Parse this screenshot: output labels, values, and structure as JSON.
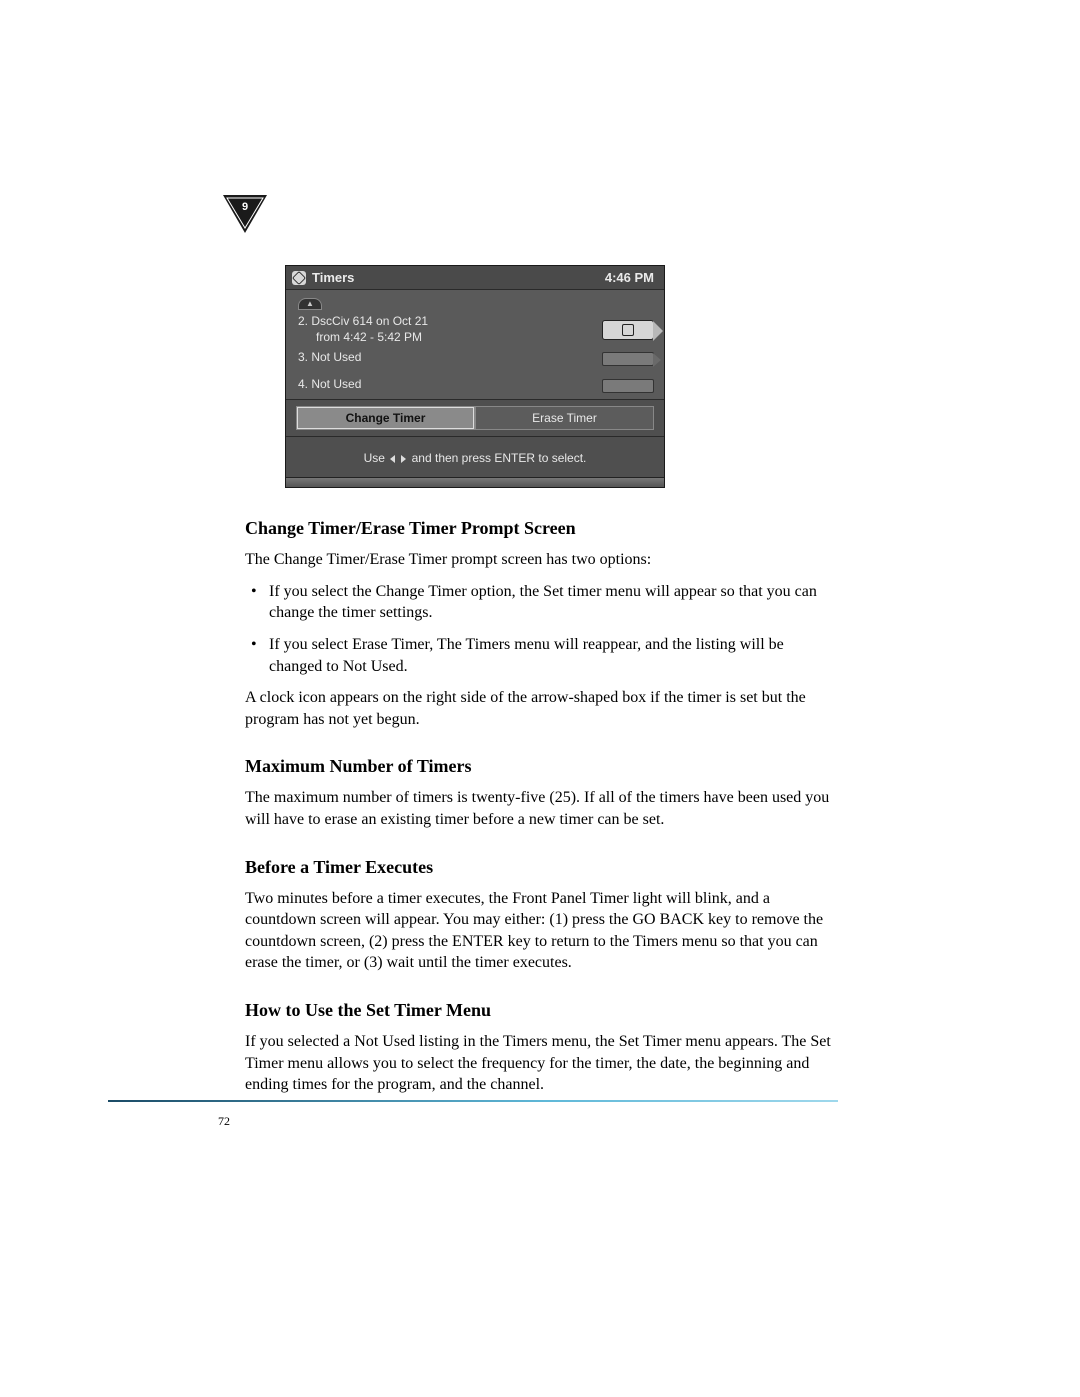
{
  "marker": {
    "number": "9"
  },
  "screenshot": {
    "title": "Timers",
    "time": "4:46 PM",
    "rows": [
      {
        "line1": "2.  DscCiv 614 on Oct 21",
        "line2": "from 4:42 - 5:42 PM",
        "has_clock": true
      },
      {
        "line1": "3.  Not Used",
        "line2": "",
        "has_clock": false
      },
      {
        "line1": "4.  Not Used",
        "line2": "",
        "has_clock": false
      }
    ],
    "buttons": {
      "change": "Change Timer",
      "erase": "Erase Timer"
    },
    "hint_prefix": "Use ",
    "hint_suffix": " and then press ENTER to select."
  },
  "sections": {
    "s1": {
      "heading": "Change Timer/Erase Timer Prompt Screen",
      "p1": "The Change Timer/Erase Timer prompt screen has two options:",
      "bullets": [
        "If you select the Change Timer option, the Set timer menu will appear so that you can change the timer settings.",
        "If you select Erase Timer, The Timers menu will reappear, and the listing will be changed to Not Used."
      ],
      "p2": "A clock icon appears on the right side of the arrow-shaped box if the timer is set but the program has not yet begun."
    },
    "s2": {
      "heading": "Maximum Number of Timers",
      "p1": "The maximum number of timers is twenty-five (25). If all of the timers have been used you will have to erase an existing timer before a new timer can be set."
    },
    "s3": {
      "heading": "Before a Timer Executes",
      "p1": "Two minutes before a timer executes, the Front Panel Timer light will blink, and a countdown screen will appear. You may either: (1) press the GO BACK key to remove the countdown screen, (2) press the ENTER key to return to the Timers menu so that you can erase the timer, or (3) wait until the timer executes."
    },
    "s4": {
      "heading": "How to Use the Set Timer Menu",
      "p1": "If you selected a Not Used listing in the Timers menu, the Set Timer menu appears. The Set Timer menu allows you to select the frequency for the timer, the date, the beginning and ending times for the program, and the channel."
    }
  },
  "page_number": "72"
}
